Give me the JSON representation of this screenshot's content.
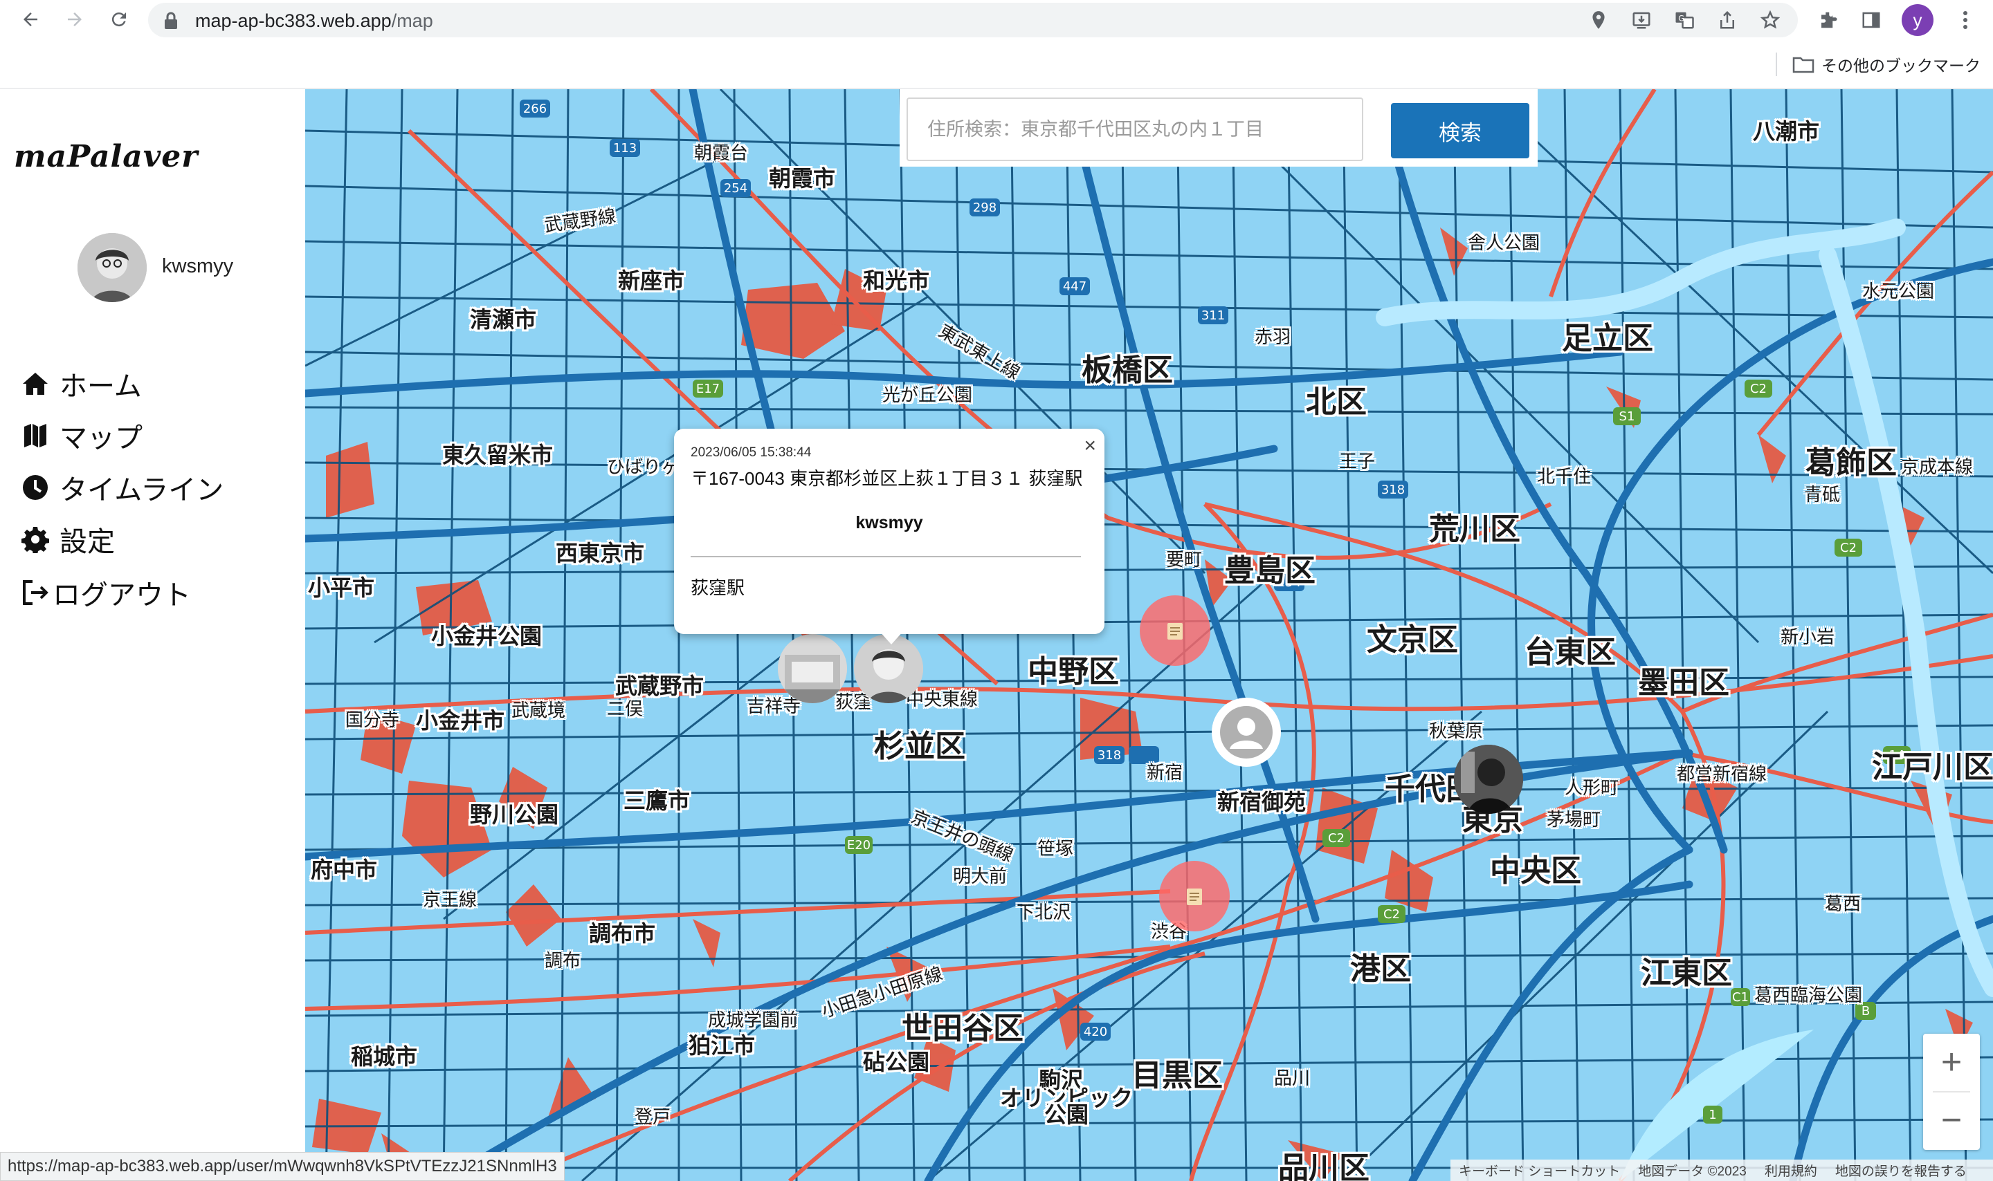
{
  "browser": {
    "url_host": "map-ap-bc383.web.app",
    "url_path": "/map",
    "profile_initial": "y",
    "bookmark_folder_label": "その他のブックマーク",
    "status_url": "https://map-ap-bc383.web.app/user/mWwqwnh8VkSPtVTEzzJ21SNnmlH3"
  },
  "sidebar": {
    "logo": "maPalaver",
    "username": "kwsmyy",
    "menu": [
      {
        "label": "ホーム",
        "icon": "home-icon"
      },
      {
        "label": "マップ",
        "icon": "map-icon"
      },
      {
        "label": "タイムライン",
        "icon": "clock-icon"
      },
      {
        "label": "設定",
        "icon": "gear-icon"
      },
      {
        "label": "ログアウト",
        "icon": "logout-icon"
      }
    ]
  },
  "search": {
    "placeholder": "住所検索：東京都千代田区丸の内１丁目",
    "button_label": "検索"
  },
  "popup": {
    "time": "2023/06/05 15:38:44",
    "address": "〒167-0043 東京都杉並区上荻１丁目３１ 荻窪駅",
    "user": "kwsmyy",
    "note": "荻窪駅",
    "close": "×"
  },
  "map": {
    "labels": [
      {
        "text": "朝霞台",
        "cls": "small"
      },
      {
        "text": "朝霞市",
        "cls": ""
      },
      {
        "text": "武蔵野線",
        "cls": "small"
      },
      {
        "text": "新座市",
        "cls": ""
      },
      {
        "text": "和光市",
        "cls": ""
      },
      {
        "text": "清瀬市",
        "cls": ""
      },
      {
        "text": "板橋区",
        "cls": "big"
      },
      {
        "text": "光が丘公園",
        "cls": "small"
      },
      {
        "text": "東武東上線",
        "cls": "small"
      },
      {
        "text": "赤羽",
        "cls": "small"
      },
      {
        "text": "北区",
        "cls": "big"
      },
      {
        "text": "足立区",
        "cls": "big"
      },
      {
        "text": "舎人公園",
        "cls": "small"
      },
      {
        "text": "八潮市",
        "cls": ""
      },
      {
        "text": "東久留米市",
        "cls": ""
      },
      {
        "text": "西東京市",
        "cls": ""
      },
      {
        "text": "小平市",
        "cls": ""
      },
      {
        "text": "小金井公園",
        "cls": ""
      },
      {
        "text": "武蔵野市",
        "cls": ""
      },
      {
        "text": "小金井市",
        "cls": ""
      },
      {
        "text": "国分寺",
        "cls": "small"
      },
      {
        "text": "武蔵境",
        "cls": "small"
      },
      {
        "text": "吉祥寺",
        "cls": "small"
      },
      {
        "text": "荻窪",
        "cls": "small"
      },
      {
        "text": "中央東線",
        "cls": "small"
      },
      {
        "text": "杉並区",
        "cls": "big"
      },
      {
        "text": "中野区",
        "cls": "big"
      },
      {
        "text": "豊島区",
        "cls": "big"
      },
      {
        "text": "要町",
        "cls": "small"
      },
      {
        "text": "荒川区",
        "cls": "big"
      },
      {
        "text": "葛飾区",
        "cls": "big"
      },
      {
        "text": "文京区",
        "cls": "big"
      },
      {
        "text": "台東区",
        "cls": "big"
      },
      {
        "text": "墨田区",
        "cls": "big"
      },
      {
        "text": "新小岩",
        "cls": "small"
      },
      {
        "text": "秋葉原",
        "cls": "small"
      },
      {
        "text": "千代田",
        "cls": "big"
      },
      {
        "text": "東京",
        "cls": "big"
      },
      {
        "text": "人形町",
        "cls": "small"
      },
      {
        "text": "茅場町",
        "cls": "small"
      },
      {
        "text": "都営新宿線",
        "cls": "small"
      },
      {
        "text": "江戸川区",
        "cls": "big"
      },
      {
        "text": "新宿",
        "cls": "small"
      },
      {
        "text": "新宿御苑",
        "cls": ""
      },
      {
        "text": "中央区",
        "cls": "big"
      },
      {
        "text": "三鷹市",
        "cls": ""
      },
      {
        "text": "野川公園",
        "cls": ""
      },
      {
        "text": "府中市",
        "cls": ""
      },
      {
        "text": "調布市",
        "cls": ""
      },
      {
        "text": "調布",
        "cls": "small"
      },
      {
        "text": "京王井の頭線",
        "cls": "small"
      },
      {
        "text": "明大前",
        "cls": "small"
      },
      {
        "text": "笹塚",
        "cls": "small"
      },
      {
        "text": "下北沢",
        "cls": "small"
      },
      {
        "text": "渋谷",
        "cls": "small"
      },
      {
        "text": "港区",
        "cls": "big"
      },
      {
        "text": "江東区",
        "cls": "big"
      },
      {
        "text": "葛西臨海公園",
        "cls": "small"
      },
      {
        "text": "小田急小田原線",
        "cls": "small"
      },
      {
        "text": "成城学園前",
        "cls": "small"
      },
      {
        "text": "狛江市",
        "cls": ""
      },
      {
        "text": "世田谷区",
        "cls": "big"
      },
      {
        "text": "砧公園",
        "cls": ""
      },
      {
        "text": "稲城市",
        "cls": ""
      },
      {
        "text": "駒沢",
        "cls": ""
      },
      {
        "text": "オリンピック",
        "cls": ""
      },
      {
        "text": "公園",
        "cls": ""
      },
      {
        "text": "目黒区",
        "cls": "big"
      },
      {
        "text": "品川",
        "cls": "small"
      },
      {
        "text": "品川区",
        "cls": "big"
      },
      {
        "text": "登戸",
        "cls": "small"
      },
      {
        "text": "京王線",
        "cls": "small"
      },
      {
        "text": "王子",
        "cls": "small"
      },
      {
        "text": "北千住",
        "cls": "small"
      },
      {
        "text": "青砥",
        "cls": "small"
      },
      {
        "text": "水元公園",
        "cls": "small"
      },
      {
        "text": "ひばりヶ丘",
        "cls": "small"
      },
      {
        "text": "二俣",
        "cls": "small"
      },
      {
        "text": "葛西",
        "cls": "small"
      },
      {
        "text": "京成本線",
        "cls": "small"
      }
    ]
  },
  "controls": {
    "zoom_in": "+",
    "zoom_out": "−"
  },
  "attribution": {
    "shortcuts": "キーボード ショートカット",
    "data": "地図データ ©2023",
    "terms": "利用規約",
    "report": "地図の誤りを報告する"
  },
  "colors": {
    "water": "#8fd3f4",
    "highway": "#1e6fb0",
    "road": "#0e4f7a",
    "rail": "#e85d4a",
    "park": "#e45b45",
    "search_button": "#1a73b8"
  }
}
